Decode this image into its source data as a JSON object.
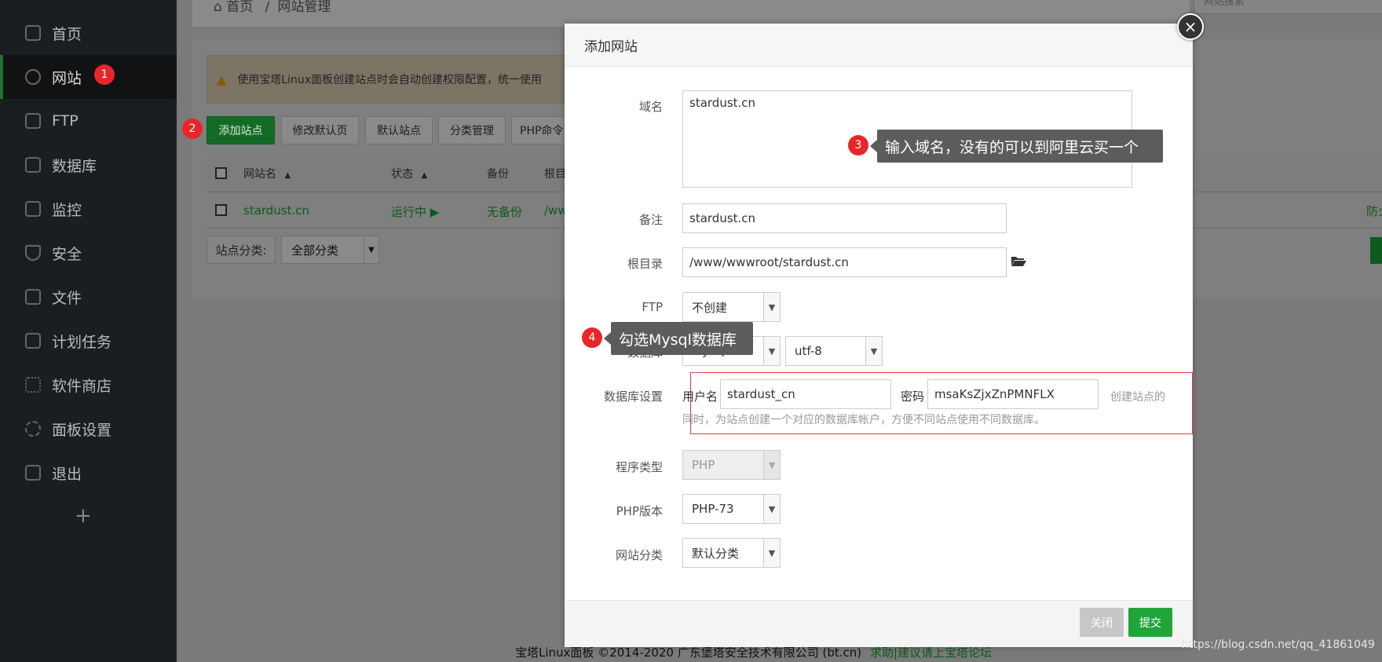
{
  "sidebar": {
    "items": [
      {
        "label": "首页",
        "icon": "home-icon"
      },
      {
        "label": "网站",
        "icon": "globe-icon"
      },
      {
        "label": "FTP",
        "icon": "ftp-icon"
      },
      {
        "label": "数据库",
        "icon": "database-icon"
      },
      {
        "label": "监控",
        "icon": "monitor-icon"
      },
      {
        "label": "安全",
        "icon": "shield-icon"
      },
      {
        "label": "文件",
        "icon": "folder-icon"
      },
      {
        "label": "计划任务",
        "icon": "calendar-icon"
      },
      {
        "label": "软件商店",
        "icon": "grid-icon"
      },
      {
        "label": "面板设置",
        "icon": "gear-icon"
      },
      {
        "label": "退出",
        "icon": "logout-icon"
      }
    ],
    "add_symbol": "+"
  },
  "breadcrumb": {
    "home": "首页",
    "sep": "/",
    "current": "网站管理"
  },
  "search_placeholder": "网站搜索",
  "notice": {
    "icon": "warning-icon",
    "text": "使用宝塔Linux面板创建站点时会自动创建权限配置，统一使用"
  },
  "toolbar": {
    "add_site": "添加站点",
    "modify_default_page": "修改默认页",
    "default_site": "默认站点",
    "category_manage": "分类管理",
    "php_cli": "PHP命令"
  },
  "table": {
    "headers": {
      "name": "网站名",
      "status": "状态",
      "backup": "备份",
      "root": "根目"
    },
    "row": {
      "name": "stardust.cn",
      "status": "运行中 ▶",
      "backup": "无备份",
      "root": "/ww",
      "right": "防火"
    }
  },
  "category_filter": {
    "label": "站点分类:",
    "value": "全部分类"
  },
  "annotations": {
    "one": "1",
    "two": "2",
    "three": "3",
    "four": "4"
  },
  "modal": {
    "title": "添加网站",
    "close_symbol": "×",
    "domain": {
      "label": "域名",
      "value": "stardust.cn"
    },
    "remark": {
      "label": "备注",
      "value": "stardust.cn"
    },
    "root_dir": {
      "label": "根目录",
      "value": "/www/wwwroot/stardust.cn"
    },
    "ftp": {
      "label": "FTP",
      "value": "不创建"
    },
    "database": {
      "label": "数据库",
      "value": "MySQL",
      "charset": "utf-8"
    },
    "db_settings": {
      "label": "数据库设置",
      "user_label": "用户名",
      "user_value": "stardust_cn",
      "pass_label": "密码",
      "pass_value": "msaKsZjxZnPMNFLX",
      "hint_tail": "创建站点的",
      "hint": "同时，为站点创建一个对应的数据库帐户，方便不同站点使用不同数据库。"
    },
    "program_type": {
      "label": "程序类型",
      "value": "PHP"
    },
    "php_version": {
      "label": "PHP版本",
      "value": "PHP-73"
    },
    "site_category": {
      "label": "网站分类",
      "value": "默认分类"
    },
    "buttons": {
      "close": "关闭",
      "submit": "提交"
    }
  },
  "tips": {
    "domain_tip": "输入域名，没有的可以到阿里云买一个",
    "mysql_tip": "勾选Mysql数据库"
  },
  "footer": {
    "copyright": "宝塔Linux面板 ©2014-2020 广东堡塔安全技术有限公司 (bt.cn)",
    "link": "求助|建议请上宝塔论坛"
  },
  "watermark": "https://blog.csdn.net/qq_41861049"
}
